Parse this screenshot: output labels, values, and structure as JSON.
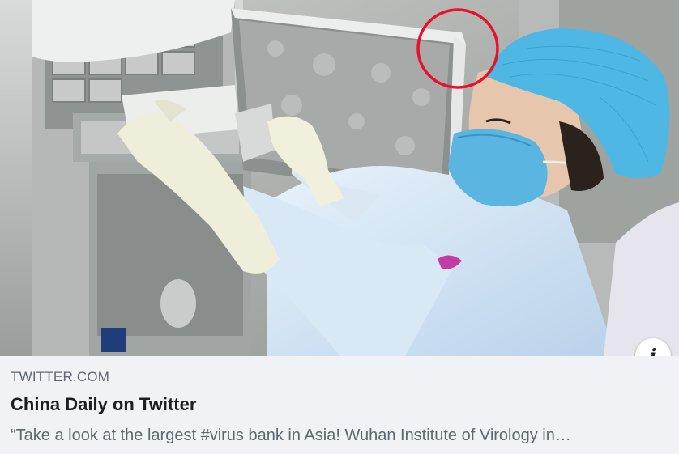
{
  "link_card": {
    "image": {
      "alt": "",
      "annotation": "red-circle",
      "annotation_color": "#e8102a"
    },
    "info_button": {
      "icon": "info-icon",
      "glyph": "i"
    },
    "domain": "TWITTER.COM",
    "title": "China Daily on Twitter",
    "description": "“Take a look at the largest #virus bank in Asia! Wuhan Institute of Virology in…"
  },
  "colors": {
    "background": "#f0f2f5",
    "domain_text": "#606770",
    "title_text": "#1c1e21",
    "annotation": "#e8102a"
  }
}
